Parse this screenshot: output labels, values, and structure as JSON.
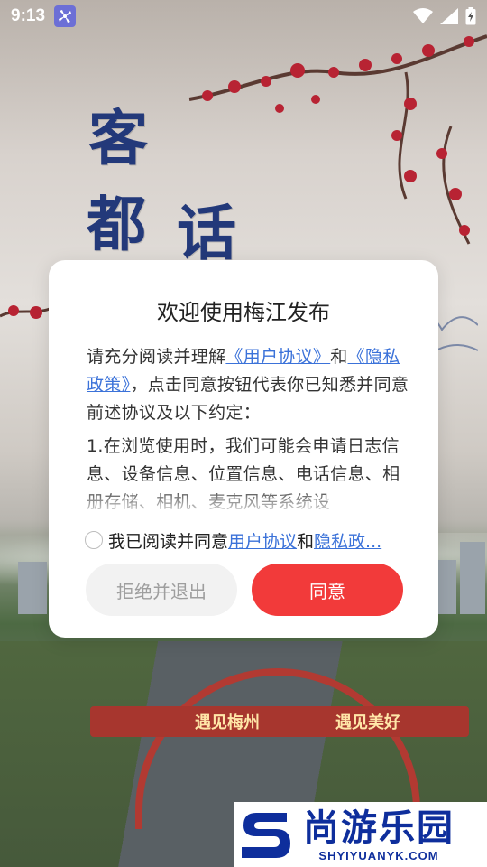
{
  "status_bar": {
    "time": "9:13"
  },
  "background": {
    "calligraphy": [
      "客",
      "都",
      "话"
    ],
    "gate_banner_left": "遇见梅州",
    "gate_banner_right": "遇见美好"
  },
  "dialog": {
    "title": "欢迎使用梅江发布",
    "intro_prefix": "请充分阅读并理解",
    "user_agreement_link": "《用户协议》",
    "intro_and": "和",
    "privacy_link": "《隐私政策》",
    "intro_suffix": "，点击同意按钮代表你已知悉并同意前述协议及以下约定：",
    "clause_1": "1.在浏览使用时，我们可能会申请日志信息、设备信息、位置信息、电话信息、相册存储、相机、麦克风等系统设",
    "consent_prefix": "我已阅读并同意",
    "consent_user_link": "用户协议",
    "consent_and": "和",
    "consent_privacy_link": "隐私政...",
    "reject_button": "拒绝并退出",
    "agree_button": "同意"
  },
  "watermark": {
    "cn": "尚游乐园",
    "en": "SHYIYUANYK.COM"
  },
  "colors": {
    "accent": "#f23a3a",
    "link": "#3b72d9",
    "brand_blue": "#0e2e9c"
  }
}
